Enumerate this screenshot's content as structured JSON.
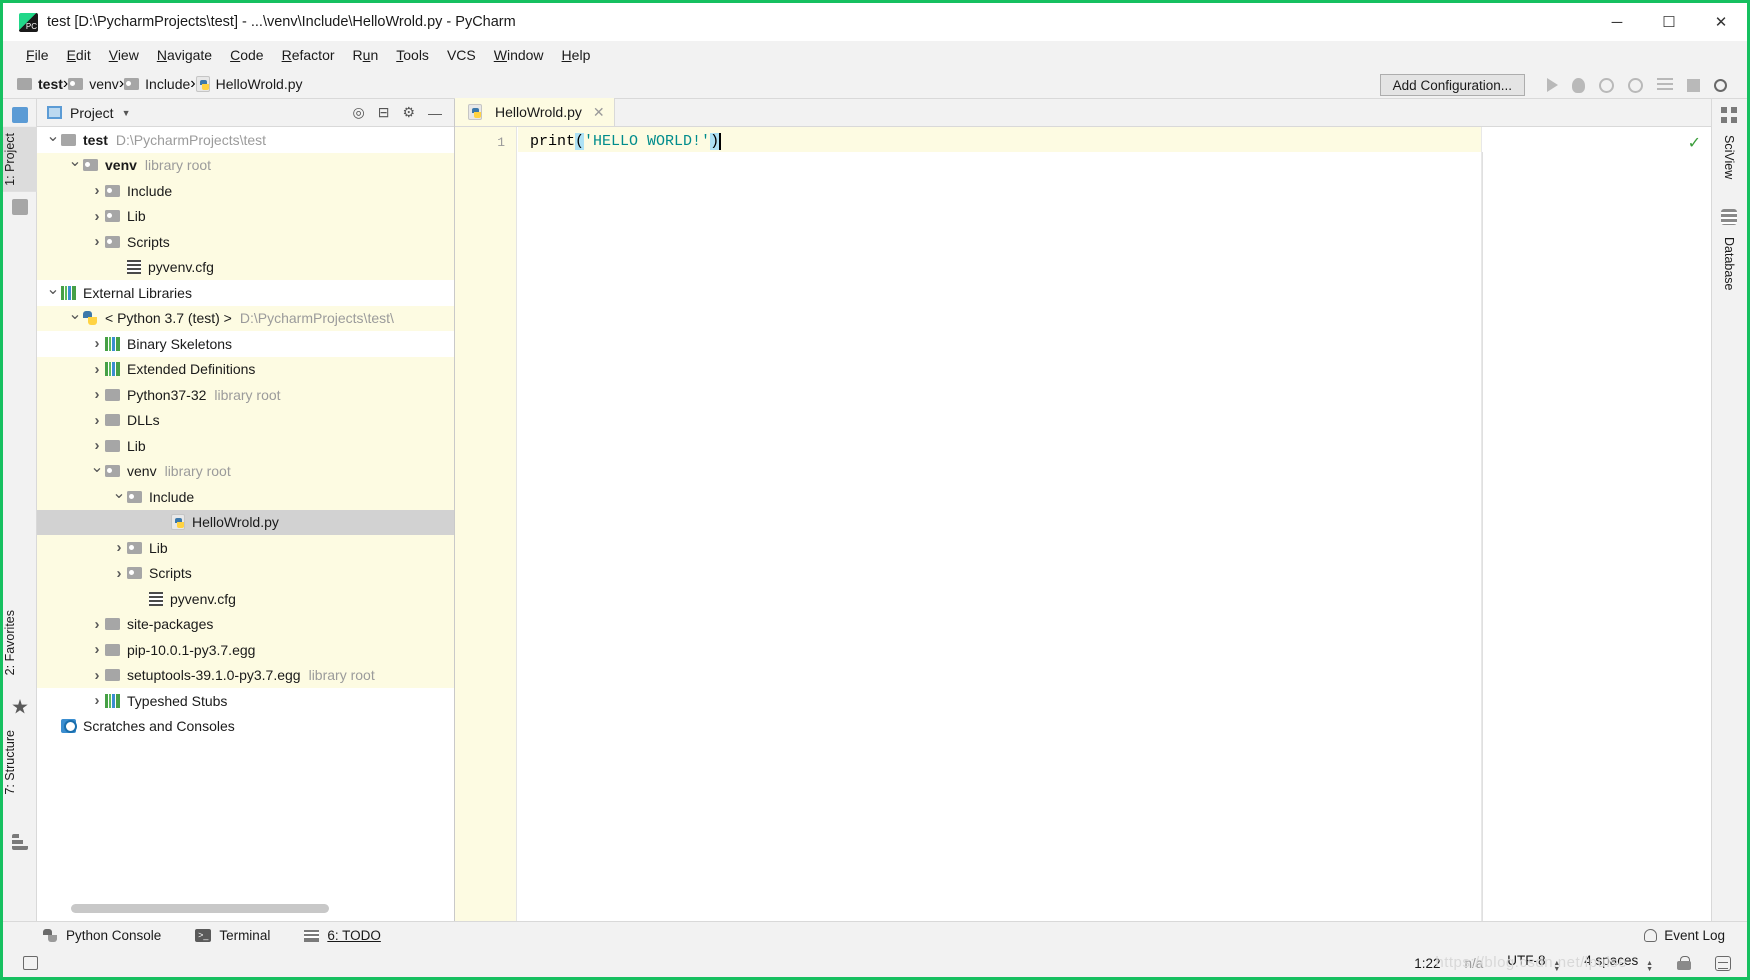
{
  "window": {
    "title": "test [D:\\PycharmProjects\\test] - ...\\venv\\Include\\HelloWrold.py - PyCharm",
    "minimize": "─",
    "maximize": "☐",
    "close": "✕"
  },
  "menu": [
    "File",
    "Edit",
    "View",
    "Navigate",
    "Code",
    "Refactor",
    "Run",
    "Tools",
    "VCS",
    "Window",
    "Help"
  ],
  "breadcrumb": [
    {
      "label": "test",
      "icon": "folder-icon",
      "bold": true
    },
    {
      "label": "venv",
      "icon": "source-folder-icon",
      "bold": false
    },
    {
      "label": "Include",
      "icon": "source-folder-icon",
      "bold": false
    },
    {
      "label": "HelloWrold.py",
      "icon": "python-file-icon",
      "bold": false
    }
  ],
  "toolbar": {
    "add_configuration": "Add Configuration...",
    "icons": [
      "run-icon",
      "debug-icon",
      "run-coverage-icon",
      "profile-icon",
      "run-with-icon",
      "stop-icon",
      "search-everywhere-icon"
    ]
  },
  "left_tool_strip": [
    {
      "label": "1: Project",
      "selected": true
    },
    {
      "label": "2: Favorites",
      "selected": false
    },
    {
      "label": "7: Structure",
      "selected": false
    }
  ],
  "right_tool_strip": [
    {
      "label": "SciView"
    },
    {
      "label": "Database"
    }
  ],
  "project_panel": {
    "header": "Project",
    "tools": [
      "target-icon",
      "collapse-all-icon",
      "gear-icon",
      "hide-icon"
    ],
    "tree": [
      {
        "indent": 0,
        "arrow": "down",
        "icon": "folder-icon",
        "label": "test",
        "bold": true,
        "detail": "D:\\PycharmProjects\\test",
        "bg": "white"
      },
      {
        "indent": 1,
        "arrow": "down",
        "icon": "source-folder-icon",
        "label": "venv",
        "bold": true,
        "detail": "library root",
        "bg": "yellow"
      },
      {
        "indent": 2,
        "arrow": "right",
        "icon": "source-folder-icon",
        "label": "Include",
        "bold": false,
        "detail": "",
        "bg": "yellow"
      },
      {
        "indent": 2,
        "arrow": "right",
        "icon": "source-folder-icon",
        "label": "Lib",
        "bold": false,
        "detail": "",
        "bg": "yellow"
      },
      {
        "indent": 2,
        "arrow": "right",
        "icon": "source-folder-icon",
        "label": "Scripts",
        "bold": false,
        "detail": "",
        "bg": "yellow"
      },
      {
        "indent": 3,
        "arrow": "none",
        "icon": "config-file-icon",
        "label": "pyvenv.cfg",
        "bold": false,
        "detail": "",
        "bg": "yellow"
      },
      {
        "indent": 0,
        "arrow": "down",
        "icon": "library-icon",
        "label": "External Libraries",
        "bold": false,
        "detail": "",
        "bg": "white"
      },
      {
        "indent": 1,
        "arrow": "down",
        "icon": "python-sdk-icon",
        "label": "< Python 3.7 (test) >",
        "bold": false,
        "detail": "D:\\PycharmProjects\\test\\",
        "bg": "yellow"
      },
      {
        "indent": 2,
        "arrow": "right",
        "icon": "library-icon",
        "label": "Binary Skeletons",
        "bold": false,
        "detail": "",
        "bg": "white"
      },
      {
        "indent": 2,
        "arrow": "right",
        "icon": "library-icon",
        "label": "Extended Definitions",
        "bold": false,
        "detail": "",
        "bg": "yellow"
      },
      {
        "indent": 2,
        "arrow": "right",
        "icon": "folder-icon",
        "label": "Python37-32",
        "bold": false,
        "detail": "library root",
        "bg": "yellow"
      },
      {
        "indent": 2,
        "arrow": "right",
        "icon": "folder-icon",
        "label": "DLLs",
        "bold": false,
        "detail": "",
        "bg": "yellow"
      },
      {
        "indent": 2,
        "arrow": "right",
        "icon": "folder-icon",
        "label": "Lib",
        "bold": false,
        "detail": "",
        "bg": "yellow"
      },
      {
        "indent": 2,
        "arrow": "down",
        "icon": "source-folder-icon",
        "label": "venv",
        "bold": false,
        "detail": "library root",
        "bg": "yellow"
      },
      {
        "indent": 3,
        "arrow": "down",
        "icon": "source-folder-icon",
        "label": "Include",
        "bold": false,
        "detail": "",
        "bg": "yellow"
      },
      {
        "indent": 5,
        "arrow": "none",
        "icon": "python-file-icon",
        "label": "HelloWrold.py",
        "bold": false,
        "detail": "",
        "bg": "selected"
      },
      {
        "indent": 3,
        "arrow": "right",
        "icon": "source-folder-icon",
        "label": "Lib",
        "bold": false,
        "detail": "",
        "bg": "yellow"
      },
      {
        "indent": 3,
        "arrow": "right",
        "icon": "source-folder-icon",
        "label": "Scripts",
        "bold": false,
        "detail": "",
        "bg": "yellow"
      },
      {
        "indent": 4,
        "arrow": "none",
        "icon": "config-file-icon",
        "label": "pyvenv.cfg",
        "bold": false,
        "detail": "",
        "bg": "yellow"
      },
      {
        "indent": 2,
        "arrow": "right",
        "icon": "folder-icon",
        "label": "site-packages",
        "bold": false,
        "detail": "",
        "bg": "yellow"
      },
      {
        "indent": 2,
        "arrow": "right",
        "icon": "folder-icon",
        "label": "pip-10.0.1-py3.7.egg",
        "bold": false,
        "detail": "",
        "bg": "yellow"
      },
      {
        "indent": 2,
        "arrow": "right",
        "icon": "folder-icon",
        "label": "setuptools-39.1.0-py3.7.egg",
        "bold": false,
        "detail": "library root",
        "bg": "yellow"
      },
      {
        "indent": 2,
        "arrow": "right",
        "icon": "library-icon",
        "label": "Typeshed Stubs",
        "bold": false,
        "detail": "",
        "bg": "white"
      },
      {
        "indent": 0,
        "arrow": "none",
        "icon": "scratches-icon",
        "label": "Scratches and Consoles",
        "bold": false,
        "detail": "",
        "bg": "white"
      }
    ]
  },
  "editor": {
    "tab": {
      "label": "HelloWrold.py",
      "close": "✕",
      "icon": "python-file-icon"
    },
    "line_number": "1",
    "code": {
      "function": "print",
      "open_paren": "(",
      "string": "'HELLO WORLD!'",
      "close_paren": ")"
    },
    "inspection_status": "✓"
  },
  "bottom_bar": {
    "items": [
      {
        "label": "Python Console",
        "icon": "python-console-icon"
      },
      {
        "label": "Terminal",
        "icon": "terminal-icon"
      },
      {
        "label": "6: TODO",
        "icon": "todo-icon",
        "mnemonic": "6"
      }
    ],
    "event_log": "Event Log"
  },
  "status_bar": {
    "position": "1:22",
    "git_branch": "n/a",
    "encoding": "UTF-8",
    "indent": "4 spaces",
    "icons": [
      "lock-icon",
      "inspection-level-icon"
    ]
  },
  "watermark": "https://blog.csdn.net/lpulse"
}
